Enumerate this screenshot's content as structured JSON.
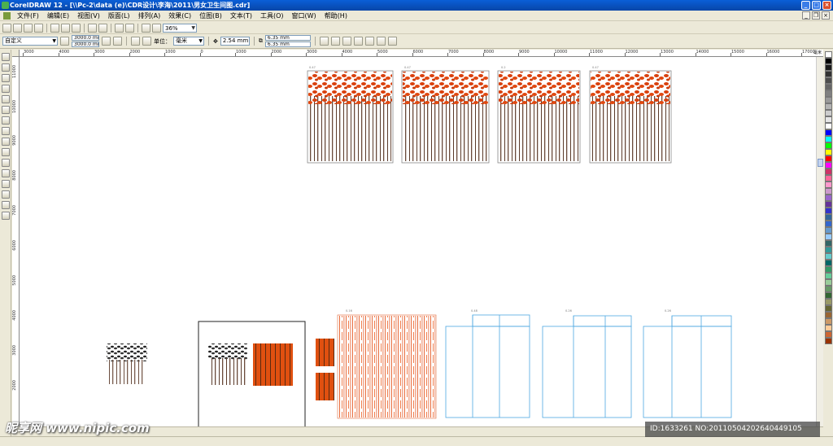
{
  "window": {
    "title": "CorelDRAW 12 - [\\\\Pc-2\\data (e)\\CDR设计\\李海\\2011\\男女卫生间图.cdr]"
  },
  "menu": {
    "items": [
      "文件(F)",
      "编辑(E)",
      "视图(V)",
      "版面(L)",
      "排列(A)",
      "效果(C)",
      "位图(B)",
      "文本(T)",
      "工具(O)",
      "窗口(W)",
      "帮助(H)"
    ]
  },
  "toolbar": {
    "zoom": "36%"
  },
  "propbar": {
    "page_size": "自定义",
    "width": "3000.0 mm",
    "height": "3000.0 mm",
    "unit_label": "单位：",
    "unit": "毫米",
    "nudge": "2.54 mm",
    "dup_x": "6.35 mm",
    "dup_y": "6.35 mm"
  },
  "ruler": {
    "top_ticks": [
      "3000",
      "4000",
      "3000",
      "2000",
      "1000",
      "0",
      "1000",
      "2000",
      "3000",
      "4000",
      "5000",
      "6000",
      "7000",
      "8000",
      "9000",
      "10000",
      "11000",
      "12000",
      "13000",
      "14000",
      "15000",
      "16000",
      "17000"
    ],
    "unit": "毫米",
    "left_ticks": [
      "11000",
      "10000",
      "9000",
      "8000",
      "7000",
      "6000",
      "5000",
      "4000",
      "3000",
      "2000"
    ]
  },
  "palette": {
    "colors": [
      "#ffffff",
      "#000000",
      "#1a1a1a",
      "#333333",
      "#4d4d4d",
      "#666666",
      "#808080",
      "#999999",
      "#b3b3b3",
      "#cccccc",
      "#e6e6e6",
      "#ffffff",
      "#0000ff",
      "#00ffff",
      "#00ff00",
      "#ffff00",
      "#ff0000",
      "#ff00ff",
      "#cc3366",
      "#ff6699",
      "#ff99cc",
      "#cc99cc",
      "#9966cc",
      "#663399",
      "#3333cc",
      "#336699",
      "#3366cc",
      "#6699cc",
      "#99ccff",
      "#336666",
      "#339999",
      "#66cccc",
      "#006666",
      "#339966",
      "#66cc99",
      "#99cc99",
      "#669966",
      "#336633",
      "#999966",
      "#666633",
      "#996633",
      "#cc9966",
      "#ffcc99",
      "#cc6633",
      "#993300"
    ]
  },
  "watermark": {
    "left": "昵享网 www.nipic.com",
    "right": "ID:1633261 NO:20110504202640449105"
  },
  "boards": {
    "top_labels": [
      "0.47",
      "0.47",
      "0.2",
      "0.47"
    ],
    "bottom_labels": [
      "0.16",
      "0.48",
      "0.26",
      "0.26"
    ]
  }
}
